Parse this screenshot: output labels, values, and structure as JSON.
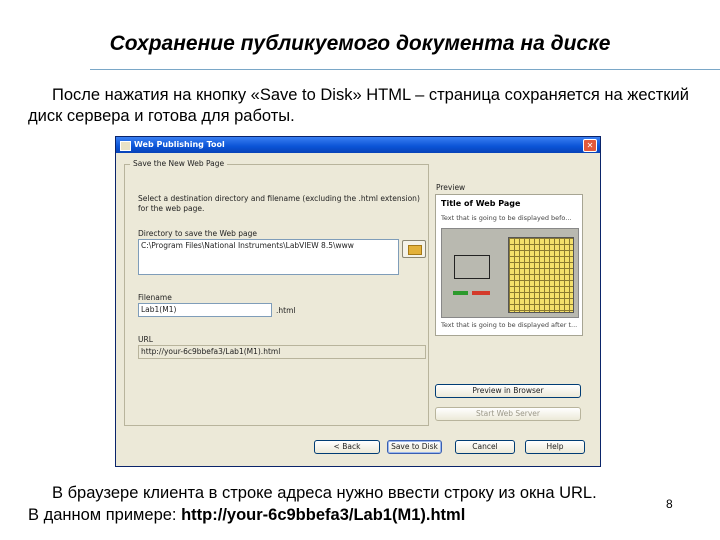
{
  "slide": {
    "title": "Сохранение публикуемого документа на диске",
    "intro": "После нажатия на кнопку «Save to Disk» HTML – страница сохраняется на жесткий диск сервера и готова для работы.",
    "footer_line1": "В браузере клиента в строке адреса нужно ввести строку из окна URL.",
    "footer_line2_prefix": "В данном примере: ",
    "footer_line2_url": "http://your-6c9bbefa3/Lab1(M1).html",
    "page_number": "8"
  },
  "dialog": {
    "title": "Web Publishing Tool",
    "group_caption": "Save the New Web Page",
    "instructions_line1": "Select a destination directory and filename (excluding the .html extension)",
    "instructions_line2": "for the web page.",
    "directory_label": "Directory to save the Web page",
    "directory_value": "C:\\Program Files\\National Instruments\\LabVIEW 8.5\\www",
    "filename_label": "Filename",
    "filename_value": "Lab1(M1)",
    "filename_ext": ".html",
    "url_label": "URL",
    "url_value": "http://your-6c9bbefa3/Lab1(M1).html",
    "preview_label": "Preview",
    "preview_title": "Title of Web Page",
    "preview_text_above": "Text that is going to be displayed befo...",
    "preview_text_below": "Text that is going to be displayed after t...",
    "preview_in_browser": "Preview in Browser",
    "start_web_server": "Start Web Server",
    "back": "< Back",
    "save_to_disk": "Save to Disk",
    "cancel": "Cancel",
    "help": "Help"
  }
}
